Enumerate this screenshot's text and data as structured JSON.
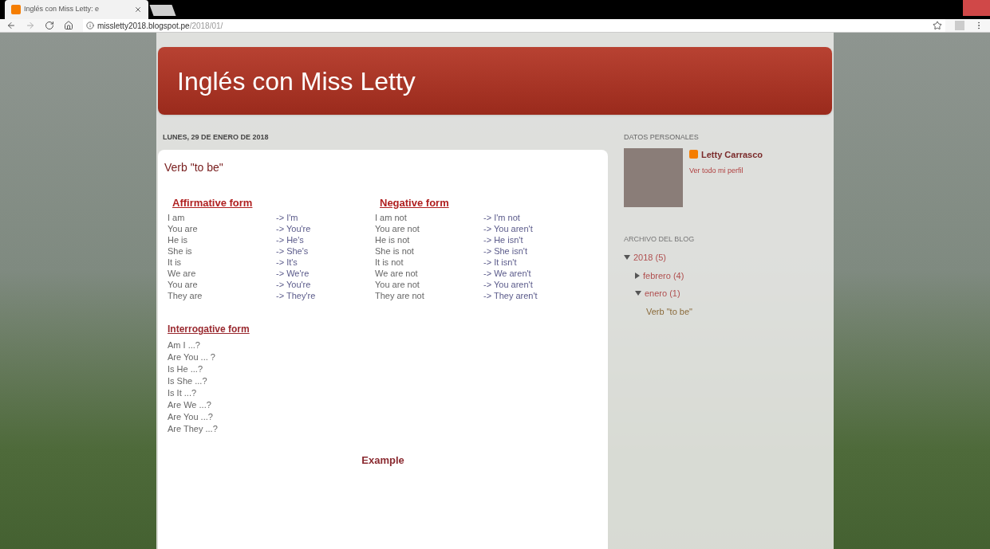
{
  "browser": {
    "tab_title": "Inglés con Miss Letty: e",
    "url_host": "missletty2018.blogspot.pe",
    "url_path": "/2018/01/"
  },
  "blog": {
    "title": "Inglés con Miss Letty"
  },
  "post": {
    "date": "LUNES, 29 DE ENERO DE 2018",
    "title": "Verb \"to be\"",
    "tables": [
      {
        "heading": "Affirmative form",
        "rows": [
          [
            "I am",
            "-> I'm"
          ],
          [
            "You are",
            "-> You're"
          ],
          [
            "He is",
            "-> He's"
          ],
          [
            "She is",
            "-> She's"
          ],
          [
            "It is",
            "-> It's"
          ],
          [
            "We are",
            "-> We're"
          ],
          [
            "You are",
            "-> You're"
          ],
          [
            "They are",
            "-> They're"
          ]
        ]
      },
      {
        "heading": "Negative form",
        "rows": [
          [
            "I am not",
            "-> I'm not"
          ],
          [
            "You are not",
            "-> You aren't"
          ],
          [
            "He is not",
            "-> He isn't"
          ],
          [
            "She is not",
            "-> She isn't"
          ],
          [
            "It is not",
            "-> It isn't"
          ],
          [
            "We are not",
            "-> We aren't"
          ],
          [
            "You are not",
            "-> You aren't"
          ],
          [
            "They are not",
            "-> They aren't"
          ]
        ]
      }
    ],
    "interrogative": {
      "heading": "Interrogative form",
      "lines": [
        "Am I ...?",
        "Are You ... ?",
        "Is He ...?",
        "Is She ...?",
        "Is It ...?",
        "Are We ...?",
        "Are You ...?",
        "Are They ...?"
      ]
    },
    "example_heading": "Example"
  },
  "sidebar": {
    "profile": {
      "heading": "DATOS PERSONALES",
      "name": "Letty Carrasco",
      "link": "Ver todo mi perfil"
    },
    "archive": {
      "heading": "ARCHIVO DEL BLOG",
      "items": [
        {
          "label": "2018 (5)",
          "kind": "folder",
          "expanded": true,
          "children": [
            {
              "label": "febrero (4)",
              "kind": "folder",
              "expanded": false
            },
            {
              "label": "enero (1)",
              "kind": "folder",
              "expanded": true,
              "children": [
                {
                  "label": "Verb \"to be\"",
                  "kind": "post"
                }
              ]
            }
          ]
        }
      ]
    }
  }
}
